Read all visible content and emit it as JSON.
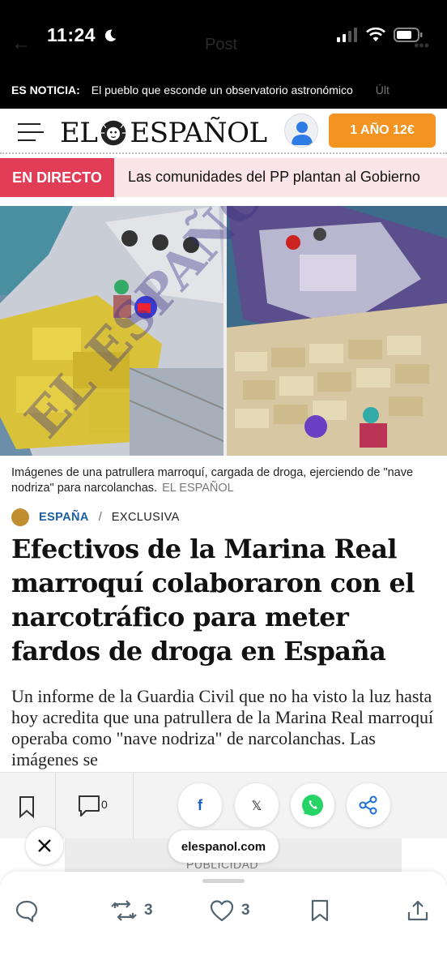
{
  "status_bar": {
    "time": "11:24",
    "ghost_title": "Post"
  },
  "ticker": {
    "label": "ES NOTICIA:",
    "text": "El pueblo que esconde un observatorio astronómico",
    "more": "Últ"
  },
  "header": {
    "logo_left": "EL",
    "logo_right": "ESPAÑOL",
    "subscribe_label": "1 AÑO 12€"
  },
  "live": {
    "label": "EN DIRECTO",
    "text": "Las comunidades del PP plantan al Gobierno"
  },
  "hero": {
    "caption": "Imágenes de una patrullera marroquí, cargada de droga, ejerciendo de \"nave nodriza\" para narcolanchas.",
    "credit": "EL ESPAÑOL"
  },
  "article": {
    "section": "ESPAÑA",
    "separator": "/",
    "tag": "EXCLUSIVA",
    "headline": "Efectivos de la Marina Real marroquí colaboraron con el narcotráfico para meter fardos de droga en España",
    "lead": "Un informe de la Guardia Civil que no ha visto la luz hasta hoy acredita que una patrullera de la Marina Real marroquí operaba como \"nave nodriza\" de narcolanchas. Las imágenes se"
  },
  "share_bar": {
    "comment_count": "0",
    "facebook_glyph": "f",
    "x_glyph": "𝕏"
  },
  "ad": {
    "label": "PUBLICIDAD",
    "domain": "elespanol.com"
  },
  "actions": {
    "repost_count": "3",
    "like_count": "3"
  },
  "colors": {
    "accent_orange": "#f39422",
    "live_red": "#e13d57",
    "section_blue": "#1b5fa2",
    "whatsapp_green": "#25d366",
    "facebook_blue": "#1877f2",
    "share_blue": "#1d6fd6"
  },
  "icons": [
    "moon-icon",
    "signal-icon",
    "wifi-icon",
    "battery-icon",
    "hamburger-icon",
    "lion-logo-icon",
    "user-icon",
    "bookmark-icon",
    "comment-icon",
    "facebook-icon",
    "x-icon",
    "whatsapp-icon",
    "share-icon",
    "close-icon",
    "reply-icon",
    "repost-icon",
    "like-icon",
    "save-icon",
    "upload-icon"
  ]
}
